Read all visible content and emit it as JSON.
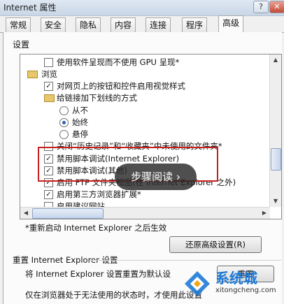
{
  "window": {
    "title": "Internet 属性",
    "help_label": "?",
    "close_label": "✕"
  },
  "tabs": [
    "常规",
    "安全",
    "隐私",
    "内容",
    "连接",
    "程序",
    "高级"
  ],
  "settings_label": "设置",
  "settings_list": [
    {
      "type": "checkbox",
      "checked": false,
      "label": "使用软件呈现而不使用 GPU 呈现*"
    },
    {
      "type": "folder",
      "label": "浏览"
    },
    {
      "type": "checkbox",
      "checked": true,
      "label": "对网页上的按钮和控件启用视觉样式"
    },
    {
      "type": "folder",
      "label": "给链接加下划线的方式"
    },
    {
      "type": "radio",
      "checked": false,
      "label": "从不"
    },
    {
      "type": "radio",
      "checked": true,
      "label": "始终"
    },
    {
      "type": "radio",
      "checked": false,
      "label": "悬停"
    },
    {
      "type": "checkbox",
      "checked": false,
      "label": "关闭“历史记录”和“收藏夹”中未使用的文件夹*"
    },
    {
      "type": "checkbox",
      "checked": true,
      "label": "禁用脚本调试(Internet Explorer)"
    },
    {
      "type": "checkbox",
      "checked": true,
      "label": "禁用脚本调试(其他)"
    },
    {
      "type": "checkbox",
      "checked": true,
      "label": "启用 FTP 文件夹视图(在 Internet Explorer 之外)"
    },
    {
      "type": "checkbox",
      "checked": true,
      "label": "启用第三方浏览器扩展*"
    },
    {
      "type": "checkbox",
      "checked": false,
      "label": "启用建议网站"
    }
  ],
  "overlay_label": "步骤阅读 ›",
  "restart_note": "*重新启动 Internet Explorer 之后生效",
  "restore_button": "还原高级设置(R)",
  "reset_title": "重置 Internet Explorer 设置",
  "reset_line1": "将 Internet Explorer 设置重置为默认设",
  "reset_button": "重置",
  "reset_line2": "仅在浏览器处于无法使用的状态时，才使用此设置",
  "watermark": {
    "text": "系统城",
    "url": "xitongcheng.com"
  }
}
